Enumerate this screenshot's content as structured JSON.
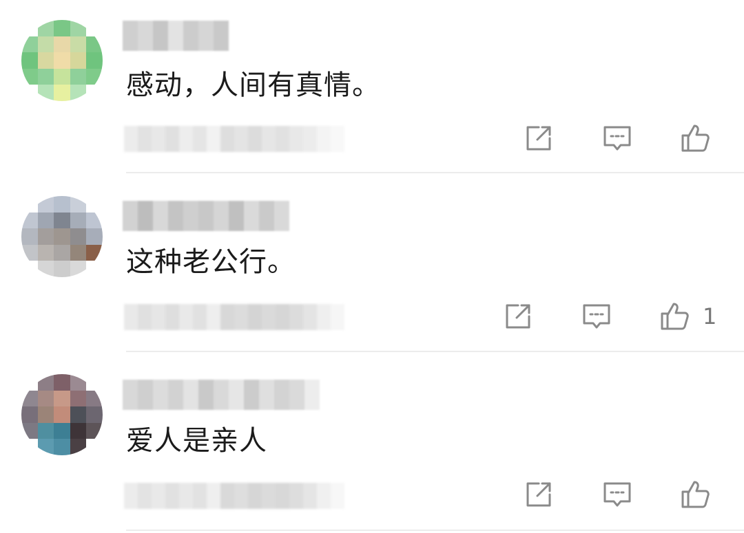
{
  "comments": [
    {
      "text": "感动，人间有真情。",
      "like_count": "",
      "icons": {
        "share": "share-icon",
        "reply": "comment-icon",
        "like": "thumbs-up-icon"
      }
    },
    {
      "text": "这种老公行。",
      "like_count": "1",
      "icons": {
        "share": "share-icon",
        "reply": "comment-icon",
        "like": "thumbs-up-icon"
      }
    },
    {
      "text": "爱人是亲人",
      "like_count": "",
      "icons": {
        "share": "share-icon",
        "reply": "comment-icon",
        "like": "thumbs-up-icon"
      }
    }
  ],
  "colors": {
    "icon": "#8a8a8a",
    "divider": "#ececec",
    "text": "#1b1b1b"
  }
}
